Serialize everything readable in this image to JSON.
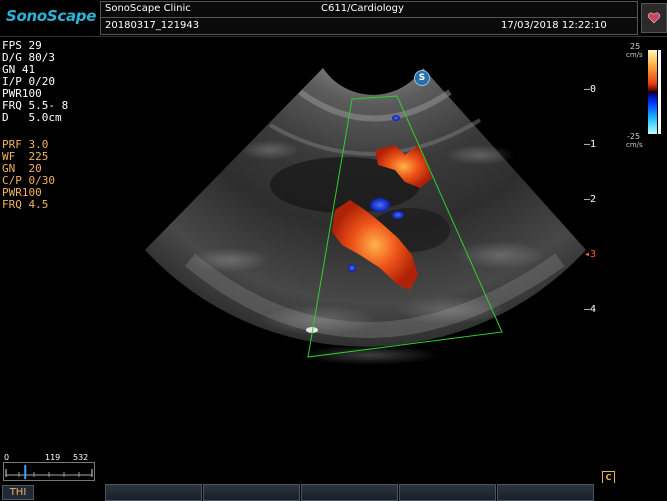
{
  "header": {
    "brand": "SonoScape",
    "clinic": "SonoScape Clinic",
    "probe_preset": "C611/Cardiology",
    "patient_id": "20180317_121943",
    "datetime": "17/03/2018 12:22:10"
  },
  "b_mode_params": [
    {
      "label": "FPS",
      "value": "29"
    },
    {
      "label": "D/G",
      "value": "80/3"
    },
    {
      "label": "GN",
      "value": "41"
    },
    {
      "label": "I/P",
      "value": "0/20"
    },
    {
      "label": "PWR",
      "value": "100"
    },
    {
      "label": "FRQ",
      "value": "5.5- 8"
    },
    {
      "label": "D",
      "value": "5.0cm"
    }
  ],
  "color_params": [
    {
      "label": "PRF",
      "value": "3.0"
    },
    {
      "label": "WF",
      "value": "225"
    },
    {
      "label": "GN",
      "value": "20"
    },
    {
      "label": "C/P",
      "value": "0/30"
    },
    {
      "label": "PWR",
      "value": "100"
    },
    {
      "label": "FRQ",
      "value": "4.5"
    }
  ],
  "color_scale": {
    "max": "25",
    "max_unit": "cm/s",
    "min": "-25",
    "min_unit": "cm/s"
  },
  "depth_scale": [
    "0",
    "1",
    "2",
    "3",
    "4"
  ],
  "probe_badge": "S",
  "mode_label": "THI",
  "cine_slider": {
    "start": "0",
    "current": "119",
    "end": "532",
    "position_fraction": 0.224
  },
  "c_icon_label": "C",
  "colors": {
    "brand": "#2bb3d6",
    "param_orange": "#f2b35a",
    "roi_box": "#2ed02e"
  }
}
